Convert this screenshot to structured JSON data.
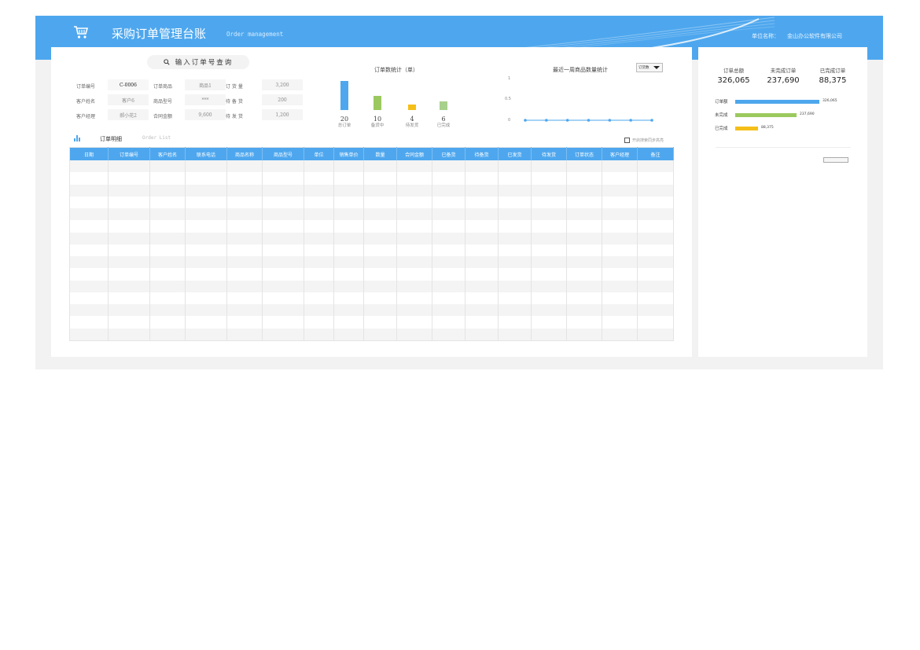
{
  "header": {
    "title": "采购订单管理台账",
    "subtitle": "Order management",
    "unit_label": "单位名称：",
    "unit_value": "金山办公软件有限公司",
    "icon": "shopping-cart-icon"
  },
  "search": {
    "label": "输入订单号查询",
    "icon": "search-icon"
  },
  "fields": [
    {
      "label": "订单编号",
      "value": "C-0006"
    },
    {
      "label": "订单商品",
      "value": "商品1"
    },
    {
      "label": "订 货 量",
      "value": "3,200"
    },
    {
      "label": "客户姓名",
      "value": "客户6"
    },
    {
      "label": "商品型号",
      "value": "***"
    },
    {
      "label": "待 备 货",
      "value": "200"
    },
    {
      "label": "客户经理",
      "value": "郝小花2"
    },
    {
      "label": "合同金额",
      "value": "9,600"
    },
    {
      "label": "待 发 货",
      "value": "1,200"
    }
  ],
  "chart_data": [
    {
      "type": "bar",
      "title": "订单数统计（单）",
      "categories": [
        "总订单",
        "备货中",
        "待发货",
        "已完成"
      ],
      "values": [
        20,
        10,
        4,
        6
      ],
      "colors": [
        "#4ea7ee",
        "#9bc95f",
        "#f5bf1a",
        "#a8d08d"
      ],
      "ylim": [
        0,
        20
      ]
    },
    {
      "type": "line",
      "title": "最近一周商品数量统计",
      "x": [
        1,
        2,
        3,
        4,
        5,
        6,
        7
      ],
      "values": [
        0,
        0,
        0,
        0,
        0,
        0,
        0
      ],
      "yticks": [
        "1",
        "0.5",
        "0"
      ],
      "ylim": [
        0,
        1
      ],
      "color": "#4ea7ee",
      "selector": "订货数"
    }
  ],
  "table": {
    "section_title": "订单明细",
    "section_en": "Order List",
    "section_icon": "bar-chart-icon",
    "sync_label": "开启搜索同步高亮",
    "columns": [
      "日期",
      "订单编号",
      "客户姓名",
      "联系电话",
      "商品名称",
      "商品型号",
      "单位",
      "销售单价",
      "数量",
      "合同金额",
      "已备货",
      "待备货",
      "已发货",
      "待发货",
      "订单状态",
      "客户经理",
      "备注"
    ],
    "row_count": 15
  },
  "summary": {
    "stats": [
      {
        "label": "订单总额",
        "value": "326,065"
      },
      {
        "label": "未完成订单",
        "value": "237,690"
      },
      {
        "label": "已完成订单",
        "value": "88,375"
      }
    ],
    "bars": [
      {
        "label": "订单额",
        "value": 326065,
        "text": "326,065",
        "color": "#4ea7ee"
      },
      {
        "label": "未完成",
        "value": 237690,
        "text": "237,690",
        "color": "#9bc95f"
      },
      {
        "label": "已完成",
        "value": 88375,
        "text": "88,375",
        "color": "#f5bf1a"
      }
    ]
  }
}
